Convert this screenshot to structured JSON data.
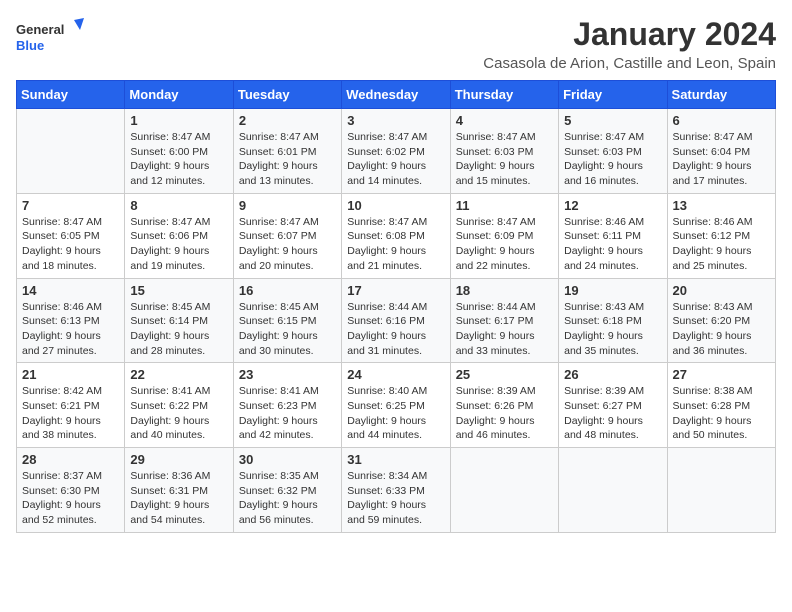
{
  "header": {
    "logo_line1": "General",
    "logo_line2": "Blue",
    "title": "January 2024",
    "subtitle": "Casasola de Arion, Castille and Leon, Spain"
  },
  "calendar": {
    "days_of_week": [
      "Sunday",
      "Monday",
      "Tuesday",
      "Wednesday",
      "Thursday",
      "Friday",
      "Saturday"
    ],
    "weeks": [
      [
        {
          "day": "",
          "content": ""
        },
        {
          "day": "1",
          "content": "Sunrise: 8:47 AM\nSunset: 6:00 PM\nDaylight: 9 hours\nand 12 minutes."
        },
        {
          "day": "2",
          "content": "Sunrise: 8:47 AM\nSunset: 6:01 PM\nDaylight: 9 hours\nand 13 minutes."
        },
        {
          "day": "3",
          "content": "Sunrise: 8:47 AM\nSunset: 6:02 PM\nDaylight: 9 hours\nand 14 minutes."
        },
        {
          "day": "4",
          "content": "Sunrise: 8:47 AM\nSunset: 6:03 PM\nDaylight: 9 hours\nand 15 minutes."
        },
        {
          "day": "5",
          "content": "Sunrise: 8:47 AM\nSunset: 6:03 PM\nDaylight: 9 hours\nand 16 minutes."
        },
        {
          "day": "6",
          "content": "Sunrise: 8:47 AM\nSunset: 6:04 PM\nDaylight: 9 hours\nand 17 minutes."
        }
      ],
      [
        {
          "day": "7",
          "content": "Sunrise: 8:47 AM\nSunset: 6:05 PM\nDaylight: 9 hours\nand 18 minutes."
        },
        {
          "day": "8",
          "content": "Sunrise: 8:47 AM\nSunset: 6:06 PM\nDaylight: 9 hours\nand 19 minutes."
        },
        {
          "day": "9",
          "content": "Sunrise: 8:47 AM\nSunset: 6:07 PM\nDaylight: 9 hours\nand 20 minutes."
        },
        {
          "day": "10",
          "content": "Sunrise: 8:47 AM\nSunset: 6:08 PM\nDaylight: 9 hours\nand 21 minutes."
        },
        {
          "day": "11",
          "content": "Sunrise: 8:47 AM\nSunset: 6:09 PM\nDaylight: 9 hours\nand 22 minutes."
        },
        {
          "day": "12",
          "content": "Sunrise: 8:46 AM\nSunset: 6:11 PM\nDaylight: 9 hours\nand 24 minutes."
        },
        {
          "day": "13",
          "content": "Sunrise: 8:46 AM\nSunset: 6:12 PM\nDaylight: 9 hours\nand 25 minutes."
        }
      ],
      [
        {
          "day": "14",
          "content": "Sunrise: 8:46 AM\nSunset: 6:13 PM\nDaylight: 9 hours\nand 27 minutes."
        },
        {
          "day": "15",
          "content": "Sunrise: 8:45 AM\nSunset: 6:14 PM\nDaylight: 9 hours\nand 28 minutes."
        },
        {
          "day": "16",
          "content": "Sunrise: 8:45 AM\nSunset: 6:15 PM\nDaylight: 9 hours\nand 30 minutes."
        },
        {
          "day": "17",
          "content": "Sunrise: 8:44 AM\nSunset: 6:16 PM\nDaylight: 9 hours\nand 31 minutes."
        },
        {
          "day": "18",
          "content": "Sunrise: 8:44 AM\nSunset: 6:17 PM\nDaylight: 9 hours\nand 33 minutes."
        },
        {
          "day": "19",
          "content": "Sunrise: 8:43 AM\nSunset: 6:18 PM\nDaylight: 9 hours\nand 35 minutes."
        },
        {
          "day": "20",
          "content": "Sunrise: 8:43 AM\nSunset: 6:20 PM\nDaylight: 9 hours\nand 36 minutes."
        }
      ],
      [
        {
          "day": "21",
          "content": "Sunrise: 8:42 AM\nSunset: 6:21 PM\nDaylight: 9 hours\nand 38 minutes."
        },
        {
          "day": "22",
          "content": "Sunrise: 8:41 AM\nSunset: 6:22 PM\nDaylight: 9 hours\nand 40 minutes."
        },
        {
          "day": "23",
          "content": "Sunrise: 8:41 AM\nSunset: 6:23 PM\nDaylight: 9 hours\nand 42 minutes."
        },
        {
          "day": "24",
          "content": "Sunrise: 8:40 AM\nSunset: 6:25 PM\nDaylight: 9 hours\nand 44 minutes."
        },
        {
          "day": "25",
          "content": "Sunrise: 8:39 AM\nSunset: 6:26 PM\nDaylight: 9 hours\nand 46 minutes."
        },
        {
          "day": "26",
          "content": "Sunrise: 8:39 AM\nSunset: 6:27 PM\nDaylight: 9 hours\nand 48 minutes."
        },
        {
          "day": "27",
          "content": "Sunrise: 8:38 AM\nSunset: 6:28 PM\nDaylight: 9 hours\nand 50 minutes."
        }
      ],
      [
        {
          "day": "28",
          "content": "Sunrise: 8:37 AM\nSunset: 6:30 PM\nDaylight: 9 hours\nand 52 minutes."
        },
        {
          "day": "29",
          "content": "Sunrise: 8:36 AM\nSunset: 6:31 PM\nDaylight: 9 hours\nand 54 minutes."
        },
        {
          "day": "30",
          "content": "Sunrise: 8:35 AM\nSunset: 6:32 PM\nDaylight: 9 hours\nand 56 minutes."
        },
        {
          "day": "31",
          "content": "Sunrise: 8:34 AM\nSunset: 6:33 PM\nDaylight: 9 hours\nand 59 minutes."
        },
        {
          "day": "",
          "content": ""
        },
        {
          "day": "",
          "content": ""
        },
        {
          "day": "",
          "content": ""
        }
      ]
    ]
  }
}
